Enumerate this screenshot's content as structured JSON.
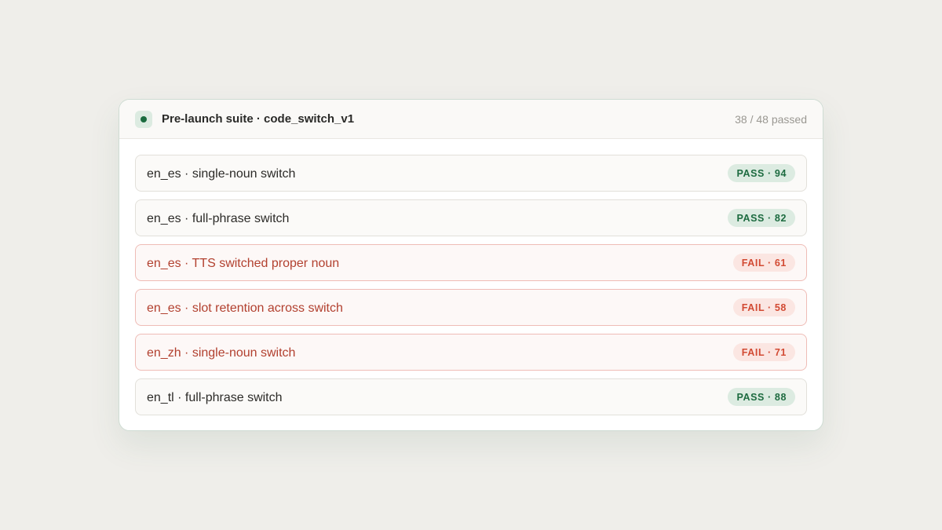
{
  "suite": {
    "title": "Pre-launch suite · code_switch_v1",
    "summary": "38 / 48 passed"
  },
  "tests": [
    {
      "label": "en_es · single-noun switch",
      "status": "pass",
      "badge": "PASS · 94"
    },
    {
      "label": "en_es · full-phrase switch",
      "status": "pass",
      "badge": "PASS · 82"
    },
    {
      "label": "en_es · TTS switched proper noun",
      "status": "fail",
      "badge": "FAIL · 61"
    },
    {
      "label": "en_es · slot retention across switch",
      "status": "fail",
      "badge": "FAIL · 58"
    },
    {
      "label": "en_zh · single-noun switch",
      "status": "fail",
      "badge": "FAIL · 71"
    },
    {
      "label": "en_tl · full-phrase switch",
      "status": "pass",
      "badge": "PASS · 88"
    }
  ],
  "colors": {
    "pass": "#1d6b40",
    "fail": "#d24a33",
    "background": "#efeeea"
  }
}
